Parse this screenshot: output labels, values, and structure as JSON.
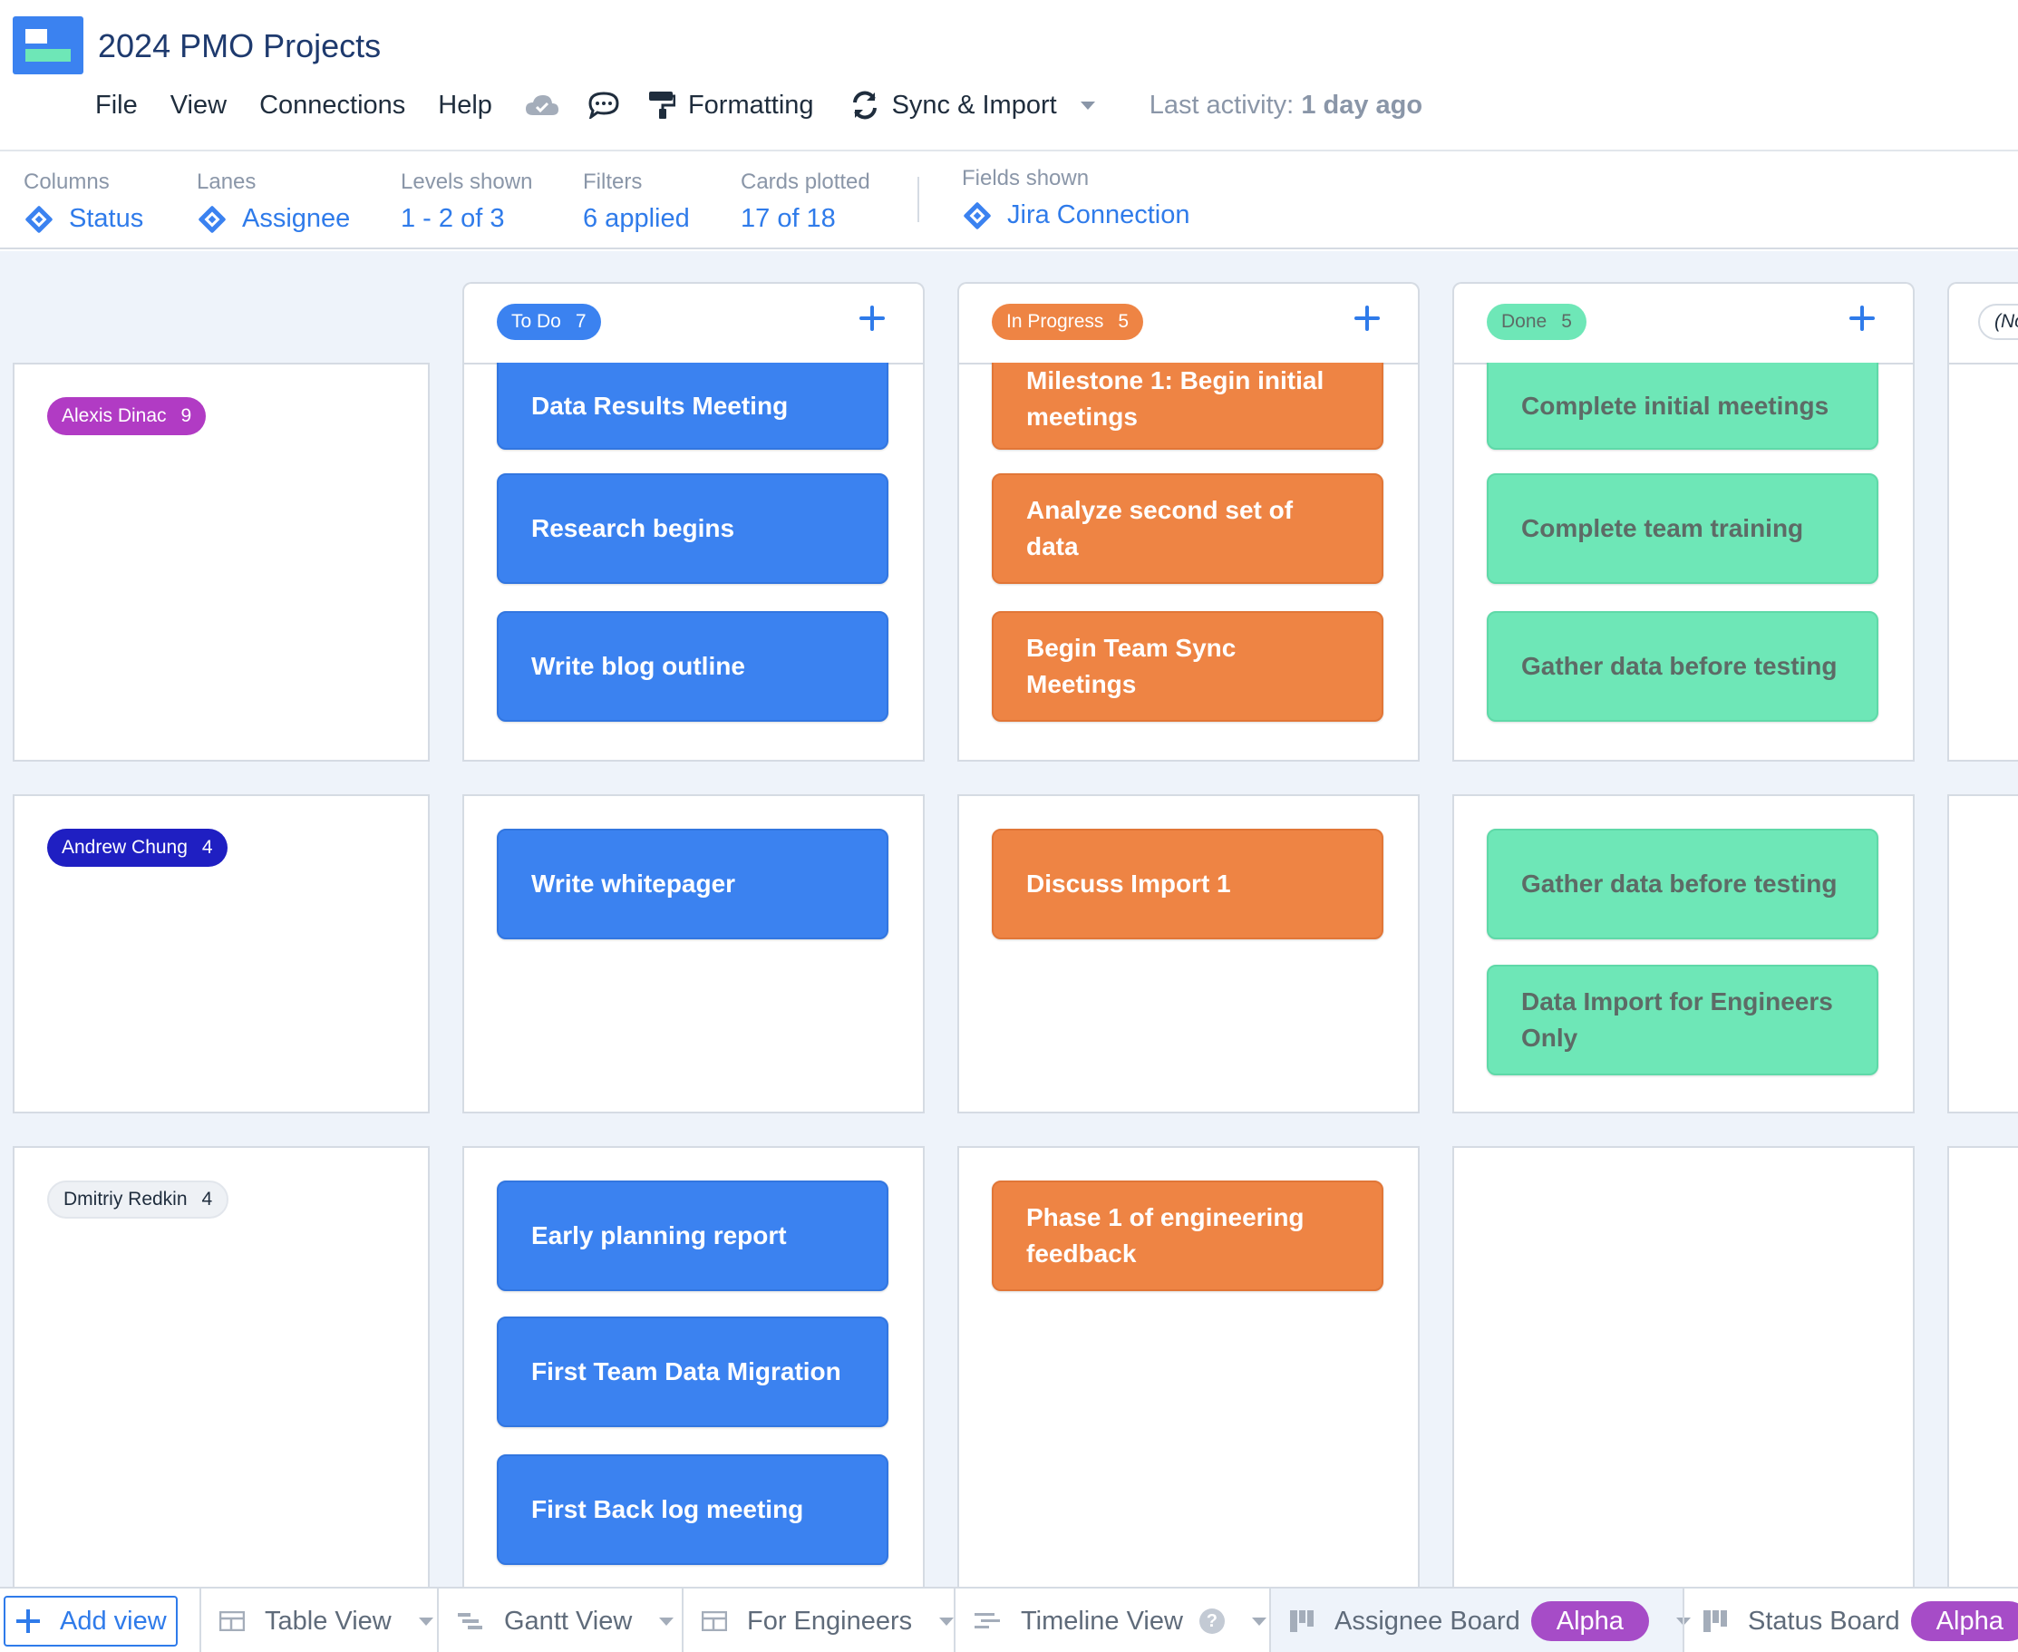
{
  "app": {
    "title": "2024 PMO Projects",
    "menu": {
      "file": "File",
      "view": "View",
      "connections": "Connections",
      "help": "Help",
      "cloud_icon": "cloud-icon",
      "comment_icon": "comment-icon",
      "formatting": "Formatting",
      "sync_import": "Sync & Import",
      "last_activity_label": "Last activity:",
      "last_activity_value": "1 day ago"
    }
  },
  "settings": {
    "columns": {
      "label": "Columns",
      "value": "Status"
    },
    "lanes": {
      "label": "Lanes",
      "value": "Assignee"
    },
    "levels": {
      "label": "Levels shown",
      "value": "1 - 2 of 3"
    },
    "filters": {
      "label": "Filters",
      "value": "6 applied"
    },
    "cards": {
      "label": "Cards plotted",
      "value": "17 of 18"
    },
    "fields": {
      "label": "Fields shown",
      "value": "Jira Connection"
    }
  },
  "columns": [
    {
      "name": "To Do",
      "count": "7",
      "color": "#3b82f0"
    },
    {
      "name": "In Progress",
      "count": "5",
      "color": "#ee8444"
    },
    {
      "name": "Done",
      "count": "5",
      "color": "#6ee7b7"
    },
    {
      "name": "(No",
      "count": ""
    }
  ],
  "lanes": [
    {
      "name": "Alexis Dinac",
      "count": "9",
      "color": "#b13bc4"
    },
    {
      "name": "Andrew Chung",
      "count": "4",
      "color": "#1f1fc2"
    },
    {
      "name": "Dmitriy Redkin",
      "count": "4",
      "color": "#eef1f5"
    }
  ],
  "cards": {
    "lane1": {
      "todo": [
        "Data Results Meeting",
        "Research begins",
        "Write blog outline"
      ],
      "progress": [
        "Milestone 1: Begin initial meetings",
        "Analyze second set of data",
        "Begin Team Sync Meetings"
      ],
      "done": [
        "Complete initial meetings",
        "Complete team training",
        "Gather data before testing"
      ]
    },
    "lane2": {
      "todo": [
        "Write whitepager"
      ],
      "progress": [
        "Discuss Import 1"
      ],
      "done": [
        "Gather data before testing",
        "Data Import for Engineers Only"
      ]
    },
    "lane3": {
      "todo": [
        "Early planning report",
        "First Team Data Migration",
        "First Back log meeting"
      ],
      "progress": [
        "Phase 1 of engineering feedback"
      ],
      "done": []
    }
  },
  "tabs": {
    "add_view": "Add view",
    "items": [
      {
        "label": "Table View",
        "icon": "table-icon"
      },
      {
        "label": "Gantt View",
        "icon": "gantt-icon"
      },
      {
        "label": "For Engineers",
        "icon": "table-icon"
      },
      {
        "label": "Timeline View",
        "icon": "timeline-icon",
        "help_icon": "help-icon"
      },
      {
        "label": "Assignee Board",
        "icon": "board-icon",
        "badge": "Alpha",
        "active": true
      },
      {
        "label": "Status Board",
        "icon": "board-icon",
        "badge": "Alpha"
      }
    ]
  }
}
